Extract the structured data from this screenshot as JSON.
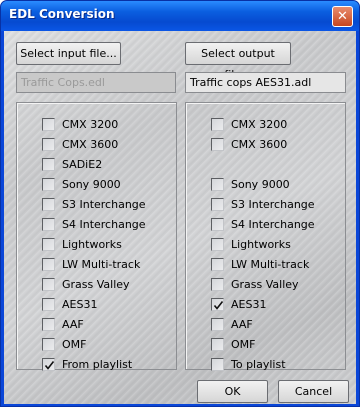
{
  "window": {
    "title": "EDL Conversion",
    "close_glyph": "✕"
  },
  "input": {
    "button_label": "Select input file...",
    "file_name": "Traffic Cops.edl",
    "options": [
      {
        "label": "CMX 3200",
        "checked": false
      },
      {
        "label": "CMX 3600",
        "checked": false
      },
      {
        "label": "SADiE2",
        "checked": false
      },
      {
        "label": "Sony 9000",
        "checked": false
      },
      {
        "label": "S3 Interchange",
        "checked": false
      },
      {
        "label": "S4 Interchange",
        "checked": false
      },
      {
        "label": "Lightworks",
        "checked": false
      },
      {
        "label": "LW Multi-track",
        "checked": false
      },
      {
        "label": "Grass Valley",
        "checked": false
      },
      {
        "label": "AES31",
        "checked": false
      },
      {
        "label": "AAF",
        "checked": false
      },
      {
        "label": "OMF",
        "checked": false
      },
      {
        "label": "From playlist",
        "checked": true
      }
    ]
  },
  "output": {
    "button_label": "Select output file...",
    "file_name": "Traffic cops AES31.adl",
    "options": [
      {
        "label": "CMX 3200",
        "checked": false
      },
      {
        "label": "CMX 3600",
        "checked": false
      },
      {
        "label": "",
        "checked": false
      },
      {
        "label": "Sony 9000",
        "checked": false
      },
      {
        "label": "S3 Interchange",
        "checked": false
      },
      {
        "label": "S4 Interchange",
        "checked": false
      },
      {
        "label": "Lightworks",
        "checked": false
      },
      {
        "label": "LW Multi-track",
        "checked": false
      },
      {
        "label": "Grass Valley",
        "checked": false
      },
      {
        "label": "AES31",
        "checked": true
      },
      {
        "label": "AAF",
        "checked": false
      },
      {
        "label": "OMF",
        "checked": false
      },
      {
        "label": "To playlist",
        "checked": false
      }
    ]
  },
  "footer": {
    "ok_label": "OK",
    "cancel_label": "Cancel"
  }
}
